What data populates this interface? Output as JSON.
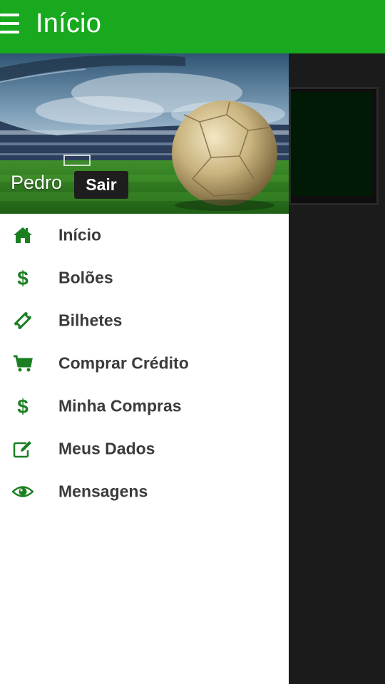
{
  "appbar": {
    "title": "Início"
  },
  "drawer": {
    "header": {
      "user_name": "Pedro",
      "logout_label": "Sair"
    },
    "items": [
      {
        "label": "Início",
        "icon": "home-icon"
      },
      {
        "label": "Bolões",
        "icon": "dollar-icon"
      },
      {
        "label": "Bilhetes",
        "icon": "ticket-icon"
      },
      {
        "label": "Comprar Crédito",
        "icon": "cart-icon"
      },
      {
        "label": "Minha Compras",
        "icon": "dollar-icon"
      },
      {
        "label": "Meus Dados",
        "icon": "edit-icon"
      },
      {
        "label": "Mensagens",
        "icon": "eye-icon"
      }
    ]
  },
  "colors": {
    "appbar": "#19a91f",
    "icon": "#1b7f22",
    "label": "#3b3b3b"
  }
}
